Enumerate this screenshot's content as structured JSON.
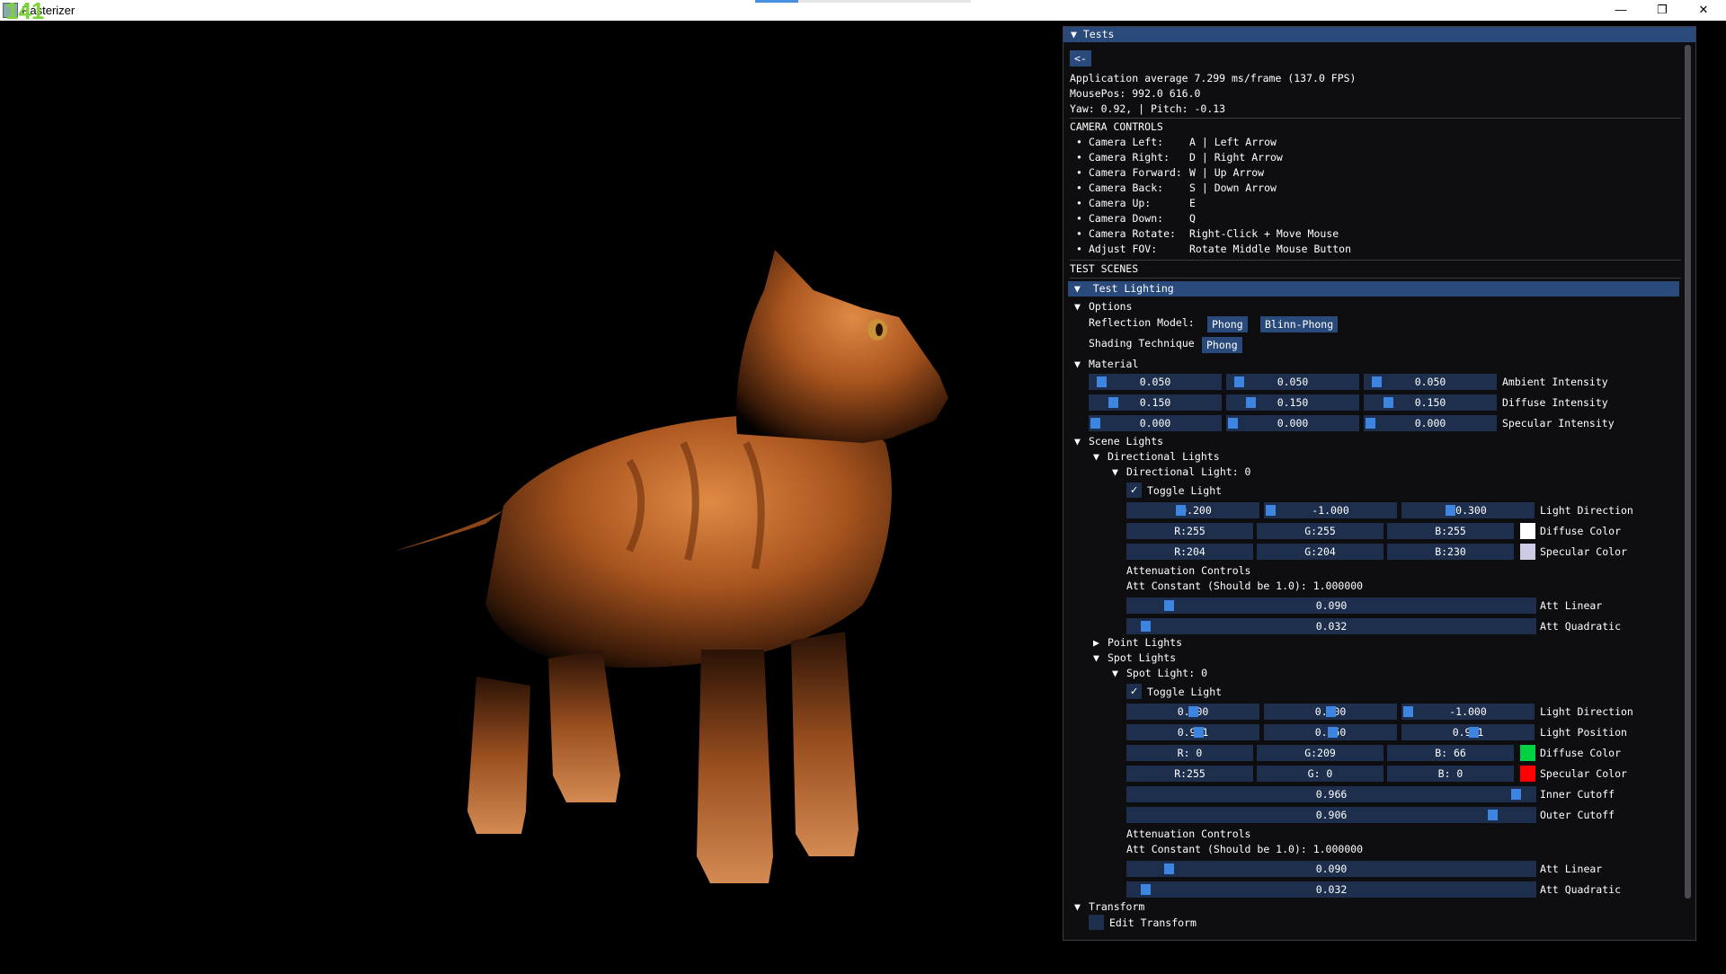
{
  "window": {
    "title": "Rasterizer",
    "fps_overlay": "141",
    "minimize": "—",
    "maximize": "❐",
    "close": "✕"
  },
  "panel": {
    "header": "Tests",
    "back_button": "<-",
    "stats": [
      "Application average 7.299 ms/frame (137.0 FPS)",
      "MousePos: 992.0 616.0",
      "Yaw: 0.92, | Pitch: -0.13"
    ],
    "camera_controls_title": "CAMERA CONTROLS",
    "camera_controls": [
      {
        "label": "Camera Left:",
        "value": "A | Left Arrow"
      },
      {
        "label": "Camera Right:",
        "value": "D | Right Arrow"
      },
      {
        "label": "Camera Forward:",
        "value": "W | Up Arrow"
      },
      {
        "label": "Camera Back:",
        "value": "S | Down Arrow"
      },
      {
        "label": "Camera Up:",
        "value": "E"
      },
      {
        "label": "Camera Down:",
        "value": "Q"
      },
      {
        "label": "Camera Rotate:",
        "value": "Right-Click + Move Mouse"
      },
      {
        "label": "Adjust FOV:",
        "value": "Rotate Middle Mouse Button"
      }
    ],
    "test_scenes_title": "TEST SCENES",
    "test_lighting": "Test Lighting",
    "options": {
      "title": "Options",
      "reflection_label": "Reflection Model:",
      "reflection_buttons": [
        "Phong",
        "Blinn-Phong"
      ],
      "shading_label": "Shading Technique",
      "shading_button": "Phong"
    },
    "material": {
      "title": "Material",
      "rows": [
        {
          "values": [
            "0.050",
            "0.050",
            "0.050"
          ],
          "fractions": [
            0.05,
            0.05,
            0.05
          ],
          "label": "Ambient Intensity"
        },
        {
          "values": [
            "0.150",
            "0.150",
            "0.150"
          ],
          "fractions": [
            0.15,
            0.15,
            0.15
          ],
          "label": "Diffuse Intensity"
        },
        {
          "values": [
            "0.000",
            "0.000",
            "0.000"
          ],
          "fractions": [
            0.0,
            0.0,
            0.0
          ],
          "label": "Specular Intensity"
        }
      ]
    },
    "scene_lights": {
      "title": "Scene Lights",
      "directional_title": "Directional Lights",
      "directional_light": {
        "title": "Directional Light: 0",
        "toggle_label": "Toggle Light",
        "direction": {
          "values": [
            "-0.200",
            "-1.000",
            "-0.300"
          ],
          "fractions": [
            0.4,
            0.0,
            0.35
          ],
          "label": "Light Direction"
        },
        "diffuse": {
          "values": [
            "R:255",
            "G:255",
            "B:255"
          ],
          "swatch": "#ffffff",
          "label": "Diffuse Color"
        },
        "specular": {
          "values": [
            "R:204",
            "G:204",
            "B:230"
          ],
          "swatch": "#ccccE6",
          "label": "Specular Color"
        },
        "attenuation_title": "Attenuation Controls",
        "att_constant": "Att Constant (Should be 1.0): 1.000000",
        "att_linear": {
          "value": "0.090",
          "fraction": 0.09,
          "label": "Att Linear"
        },
        "att_quadratic": {
          "value": "0.032",
          "fraction": 0.032,
          "label": "Att Quadratic"
        }
      },
      "point_lights_title": "Point Lights",
      "spot_title": "Spot Lights",
      "spot_light": {
        "title": "Spot Light: 0",
        "toggle_label": "Toggle Light",
        "direction": {
          "values": [
            "0.000",
            "0.000",
            "-1.000"
          ],
          "fractions": [
            0.5,
            0.5,
            0.0
          ],
          "label": "Light Direction"
        },
        "position": {
          "values": [
            "0.951",
            "0.350",
            "0.951"
          ],
          "fractions": [
            0.55,
            0.52,
            0.55
          ],
          "label": "Light Position"
        },
        "diffuse": {
          "values": [
            "R:  0",
            "G:209",
            "B: 66"
          ],
          "swatch": "#00d142",
          "label": "Diffuse Color"
        },
        "specular": {
          "values": [
            "R:255",
            "G:  0",
            "B:  0"
          ],
          "swatch": "#ff0000",
          "label": "Specular Color"
        },
        "inner_cutoff": {
          "value": "0.966",
          "fraction": 0.966,
          "label": "Inner Cutoff"
        },
        "outer_cutoff": {
          "value": "0.906",
          "fraction": 0.906,
          "label": "Outer Cutoff"
        },
        "attenuation_title": "Attenuation Controls",
        "att_constant": "Att Constant (Should be 1.0): 1.000000",
        "att_linear": {
          "value": "0.090",
          "fraction": 0.09,
          "label": "Att Linear"
        },
        "att_quadratic": {
          "value": "0.032",
          "fraction": 0.032,
          "label": "Att Quadratic"
        }
      }
    },
    "transform": {
      "title": "Transform",
      "edit_label": "Edit Transform"
    }
  },
  "colors": {
    "header": "#294a7a",
    "field": "#1d2f4d",
    "grab": "#3d85e0",
    "fps": "#7cd43a"
  }
}
